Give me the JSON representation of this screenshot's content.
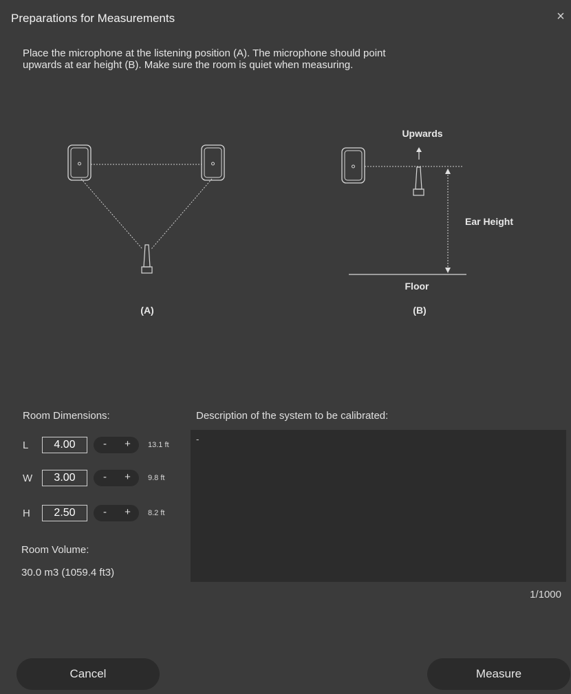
{
  "dialog": {
    "title": "Preparations for Measurements",
    "close_glyph": "×",
    "instructions_line1": "Place the microphone at the listening position (A). The microphone should point",
    "instructions_line2": "upwards at ear height (B). Make sure the room is quiet when measuring."
  },
  "diagram": {
    "a_caption": "(A)",
    "b_caption": "(B)",
    "upwards_label": "Upwards",
    "ear_height_label": "Ear Height",
    "floor_label": "Floor",
    "icons": [
      "speaker-icon",
      "microphone-icon",
      "arrow-up-icon"
    ]
  },
  "room": {
    "label": "Room Dimensions:",
    "dimensions": [
      {
        "letter": "L",
        "value": "4.00",
        "minus": "-",
        "plus": "+",
        "feet": "13.1 ft"
      },
      {
        "letter": "W",
        "value": "3.00",
        "minus": "-",
        "plus": "+",
        "feet": "9.8 ft"
      },
      {
        "letter": "H",
        "value": "2.50",
        "minus": "-",
        "plus": "+",
        "feet": "8.2 ft"
      }
    ],
    "volume_label": "Room Volume:",
    "volume_value": "30.0 m3 (1059.4 ft3)"
  },
  "description": {
    "label": "Description of the system to be calibrated:",
    "value": "-",
    "char_count": "1/1000"
  },
  "buttons": {
    "cancel": "Cancel",
    "measure": "Measure"
  },
  "colors": {
    "background": "#3b3b3b",
    "button_bg": "#2b2b2b",
    "text": "#e9e9e9"
  }
}
